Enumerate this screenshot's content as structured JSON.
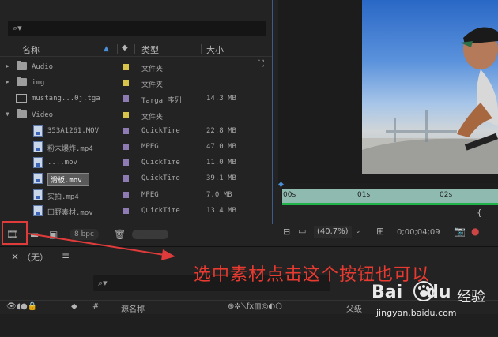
{
  "project": {
    "columns": {
      "name": "名称",
      "type": "类型",
      "size": "大小"
    },
    "rows": [
      {
        "name": "Audio",
        "type": "文件夹",
        "size": "",
        "kind": "folder",
        "expand": "▶",
        "label": "#d8c44a"
      },
      {
        "name": "img",
        "type": "文件夹",
        "size": "",
        "kind": "folder",
        "expand": "▶",
        "label": "#d8c44a"
      },
      {
        "name": "mustang...0j.tga",
        "type": "Targa 序列",
        "size": "14.3 MB",
        "kind": "targa",
        "expand": "",
        "label": "#8e7bb3"
      },
      {
        "name": "Video",
        "type": "文件夹",
        "size": "",
        "kind": "folder",
        "expand": "▼",
        "label": "#d8c44a"
      },
      {
        "name": "353A1261.MOV",
        "type": "QuickTime",
        "size": "22.8 MB",
        "kind": "media",
        "expand": "",
        "label": "#8e7bb3"
      },
      {
        "name": "粉末爆炸.mp4",
        "type": "MPEG",
        "size": "47.0 MB",
        "kind": "media",
        "expand": "",
        "label": "#8e7bb3"
      },
      {
        "name": "....mov",
        "type": "QuickTime",
        "size": "11.0 MB",
        "kind": "media",
        "expand": "",
        "label": "#8e7bb3"
      },
      {
        "name": "滑板.mov",
        "type": "QuickTime",
        "size": "39.1 MB",
        "kind": "media",
        "expand": "",
        "label": "#8e7bb3",
        "selected": true
      },
      {
        "name": "实拍.mp4",
        "type": "MPEG",
        "size": "7.0 MB",
        "kind": "media",
        "expand": "",
        "label": "#8e7bb3"
      },
      {
        "name": "田野素材.mov",
        "type": "QuickTime",
        "size": "13.4 MB",
        "kind": "media",
        "expand": "",
        "label": "#8e7bb3"
      }
    ],
    "bpc": "8 bpc"
  },
  "viewer": {
    "zoom": "(40.7%)",
    "timecode": "0;00;04;09",
    "ticks": [
      "00s",
      "01s",
      "02s"
    ]
  },
  "timeline": {
    "comp_label": "（无）",
    "header": {
      "hash": "#",
      "source_name": "源名称",
      "parent": "父级"
    }
  },
  "annotation": "选中素材点击这个按钮也可以",
  "watermark": {
    "logo": "Bai",
    "logo2": "du",
    "jy": "经验",
    "url": "jingyan.baidu.com"
  }
}
